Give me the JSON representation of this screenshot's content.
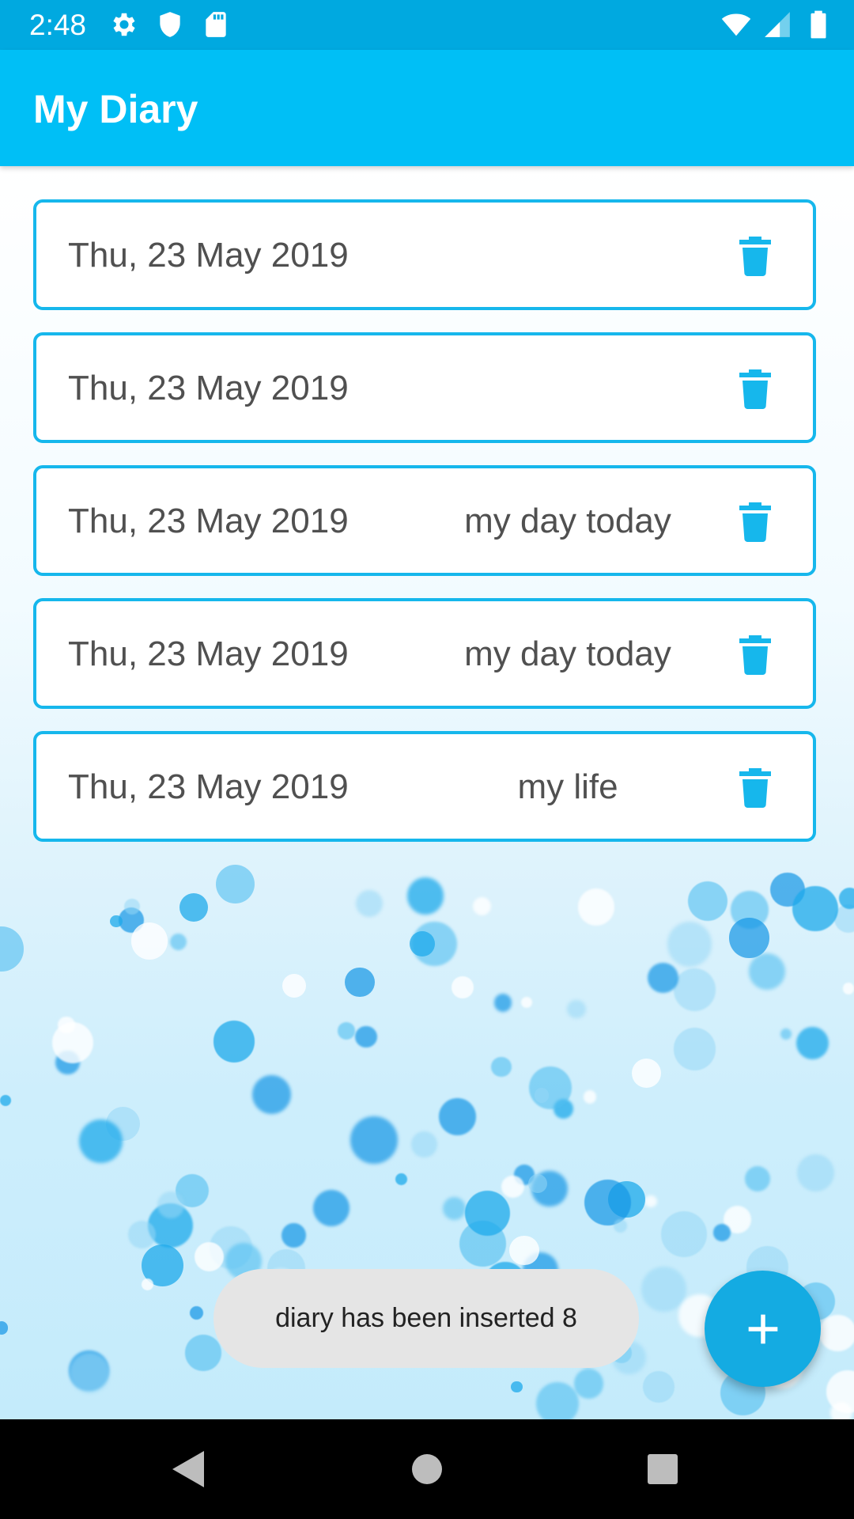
{
  "status_bar": {
    "time": "2:48",
    "left_icons": [
      "gear-icon",
      "shield-icon",
      "sd-card-icon"
    ],
    "right_icons": [
      "wifi-icon",
      "signal-icon",
      "battery-icon"
    ]
  },
  "app_bar": {
    "title": "My Diary"
  },
  "diary_entries": [
    {
      "date": "Thu, 23 May 2019",
      "title": ""
    },
    {
      "date": "Thu, 23 May 2019",
      "title": ""
    },
    {
      "date": "Thu, 23 May 2019",
      "title": "my day today"
    },
    {
      "date": "Thu, 23 May 2019",
      "title": "my day today"
    },
    {
      "date": "Thu, 23 May 2019",
      "title": "my life"
    }
  ],
  "toast": {
    "message": "diary has been inserted 8"
  },
  "fab": {
    "icon": "plus-icon"
  },
  "nav_bar": {
    "buttons": [
      "back-icon",
      "home-icon",
      "recents-icon"
    ]
  },
  "colors": {
    "status_bar": "#00a9e0",
    "app_bar": "#00bff6",
    "accent": "#16b7ec",
    "fab": "#14abe2",
    "toast_bg": "#e5e5e5"
  }
}
